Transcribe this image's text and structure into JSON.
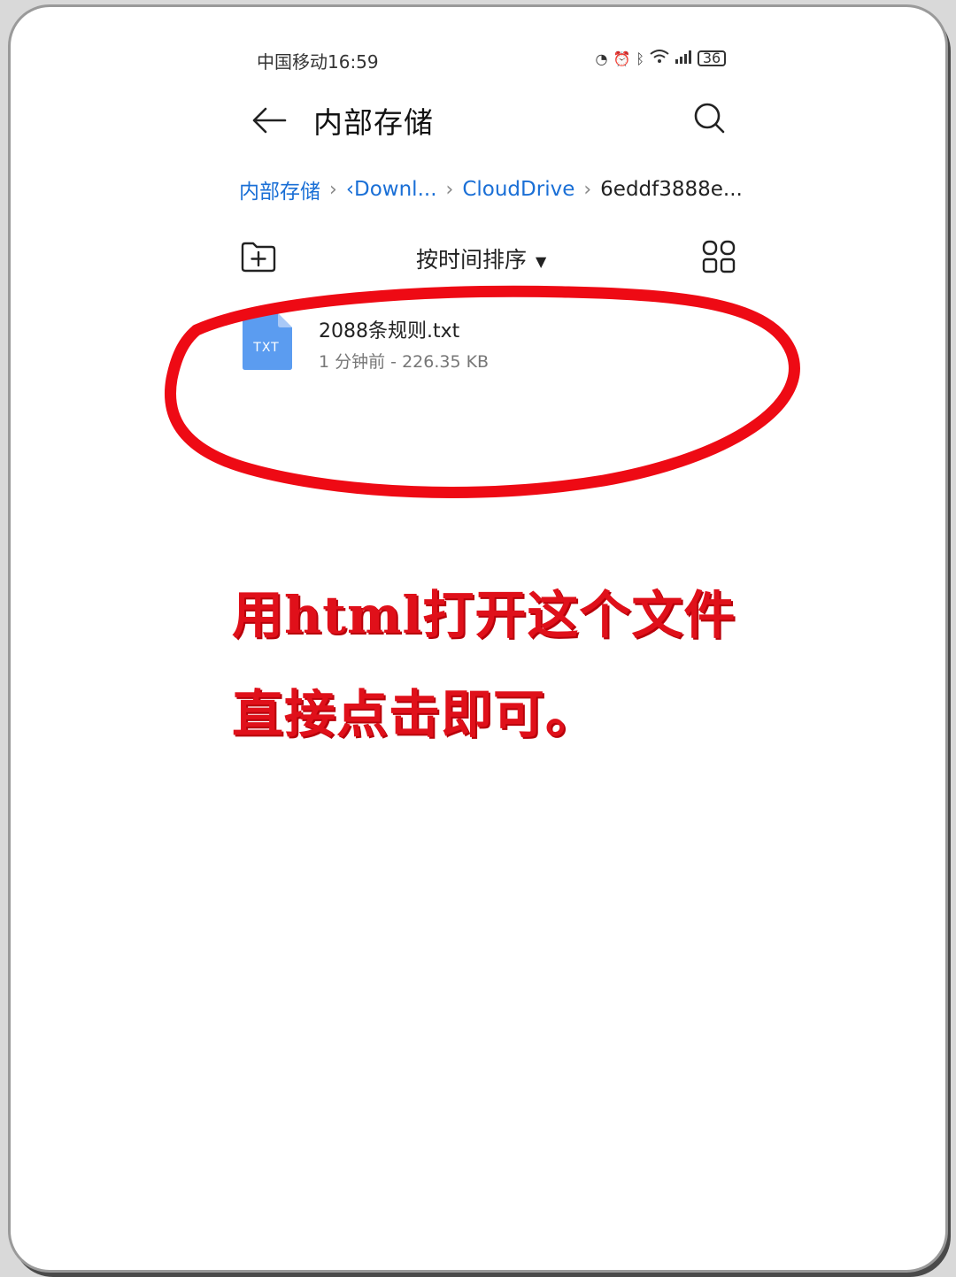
{
  "status_bar": {
    "carrier_time": "中国移动16:59",
    "battery": "36"
  },
  "header": {
    "title": "内部存储"
  },
  "breadcrumb": {
    "items": [
      "内部存储",
      "‹Downl...",
      "CloudDrive",
      "6eddf3888e..."
    ]
  },
  "toolbar": {
    "sort_label": "按时间排序"
  },
  "files": [
    {
      "icon_label": "TXT",
      "name": "2088条规则.txt",
      "meta": "1 分钟前 - 226.35 KB"
    }
  ],
  "annotation": {
    "line1": "用html打开这个文件",
    "line2": "直接点击即可。"
  },
  "colors": {
    "accent_blue": "#1a6fd6",
    "file_icon_blue": "#5b9cf0",
    "annotation_red": "#e0101a"
  },
  "icons": [
    "back-arrow-icon",
    "search-icon",
    "new-folder-icon",
    "grid-view-icon",
    "txt-file-icon"
  ]
}
